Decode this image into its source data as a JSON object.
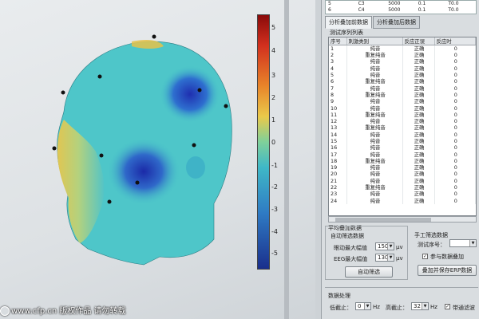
{
  "top_rows": [
    [
      "5",
      "C3",
      "5000",
      "0.1",
      "T0.0"
    ],
    [
      "6",
      "C4",
      "5000",
      "0.1",
      "T0.0"
    ]
  ],
  "tabs": [
    "分析叠加前数据",
    "分析叠加后数据"
  ],
  "sequence_list_label": "测试序列列表",
  "table": {
    "headers": [
      "序号",
      "刺激类别",
      "反应正误",
      "反应时"
    ],
    "rows": [
      [
        "1",
        "纯音",
        "正确",
        "0"
      ],
      [
        "2",
        "重复纯音",
        "正确",
        "0"
      ],
      [
        "3",
        "纯音",
        "正确",
        "0"
      ],
      [
        "4",
        "纯音",
        "正确",
        "0"
      ],
      [
        "5",
        "纯音",
        "正确",
        "0"
      ],
      [
        "6",
        "重复纯音",
        "正确",
        "0"
      ],
      [
        "7",
        "纯音",
        "正确",
        "0"
      ],
      [
        "8",
        "重复纯音",
        "正确",
        "0"
      ],
      [
        "9",
        "纯音",
        "正确",
        "0"
      ],
      [
        "10",
        "纯音",
        "正确",
        "0"
      ],
      [
        "11",
        "重复纯音",
        "正确",
        "0"
      ],
      [
        "12",
        "纯音",
        "正确",
        "0"
      ],
      [
        "13",
        "重复纯音",
        "正确",
        "0"
      ],
      [
        "14",
        "纯音",
        "正确",
        "0"
      ],
      [
        "15",
        "纯音",
        "正确",
        "0"
      ],
      [
        "16",
        "纯音",
        "正确",
        "0"
      ],
      [
        "17",
        "纯音",
        "正确",
        "0"
      ],
      [
        "18",
        "重复纯音",
        "正确",
        "0"
      ],
      [
        "19",
        "纯音",
        "正确",
        "0"
      ],
      [
        "20",
        "纯音",
        "正确",
        "0"
      ],
      [
        "21",
        "纯音",
        "正确",
        "0"
      ],
      [
        "22",
        "重复纯音",
        "正确",
        "0"
      ],
      [
        "23",
        "纯音",
        "正确",
        "0"
      ],
      [
        "24",
        "纯音",
        "正确",
        "0"
      ]
    ]
  },
  "avg": {
    "title": "平均叠加数据",
    "auto_label": "自动筛选数据",
    "eye_label": "眼动最大幅值",
    "eye_value": "150",
    "eeg_label": "EEG最大幅值",
    "eeg_value": "130",
    "unit": "μv",
    "auto_button": "自动筛选"
  },
  "manual": {
    "title": "手工筛选数据",
    "seq_label": "测试序号：",
    "seq_value": "",
    "join_label": "参与数据叠加",
    "join_checked": true,
    "save_button": "叠加并保存ERP数据"
  },
  "processing": {
    "title": "数据处理",
    "low_label": "低截止：",
    "low_value": "0",
    "high_label": "高截止：",
    "high_value": "32",
    "unit": "Hz",
    "check_label": "带通滤波"
  },
  "colorbar": {
    "ticks": [
      "5",
      "4",
      "3",
      "2",
      "1",
      "0",
      "-1",
      "-2",
      "-3",
      "-4",
      "-5"
    ],
    "min": -5,
    "max": 5
  },
  "watermark": "www.cfp.cn 版权作品 请勿转载"
}
